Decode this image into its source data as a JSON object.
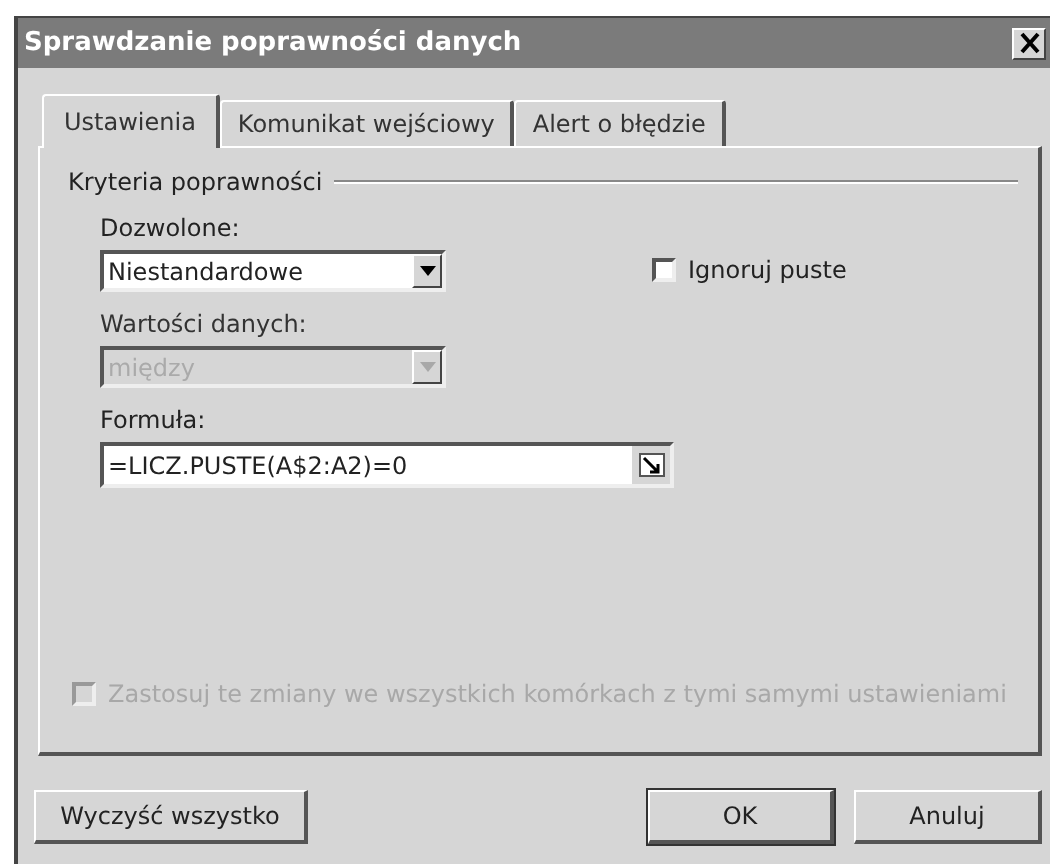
{
  "window": {
    "title": "Sprawdzanie poprawności danych"
  },
  "tabs": [
    {
      "label": "Ustawienia",
      "selected": true
    },
    {
      "label": "Komunikat wejściowy",
      "selected": false
    },
    {
      "label": "Alert o błędzie",
      "selected": false
    }
  ],
  "group": {
    "title": "Kryteria poprawności"
  },
  "fields": [
    {
      "kind": "select",
      "label": "Dozwolone:",
      "value": "Niestandardowe",
      "disabled": false
    },
    {
      "kind": "select",
      "label": "Wartości danych:",
      "value": "między",
      "disabled": true
    },
    {
      "kind": "ref",
      "label": "Formuła:",
      "value": "=LICZ.PUSTE(A$2:A2)=0",
      "disabled": false
    }
  ],
  "ignore_blank": {
    "label": "Ignoruj puste",
    "checked": false,
    "disabled": false
  },
  "apply_all": {
    "label": "Zastosuj te zmiany we wszystkich komórkach z tymi samymi ustawieniami",
    "checked": false,
    "disabled": true
  },
  "buttons": [
    {
      "label": "Wyczyść wszystko",
      "default": false
    },
    {
      "label": "OK",
      "default": true
    },
    {
      "label": "Anuluj",
      "default": false
    }
  ]
}
